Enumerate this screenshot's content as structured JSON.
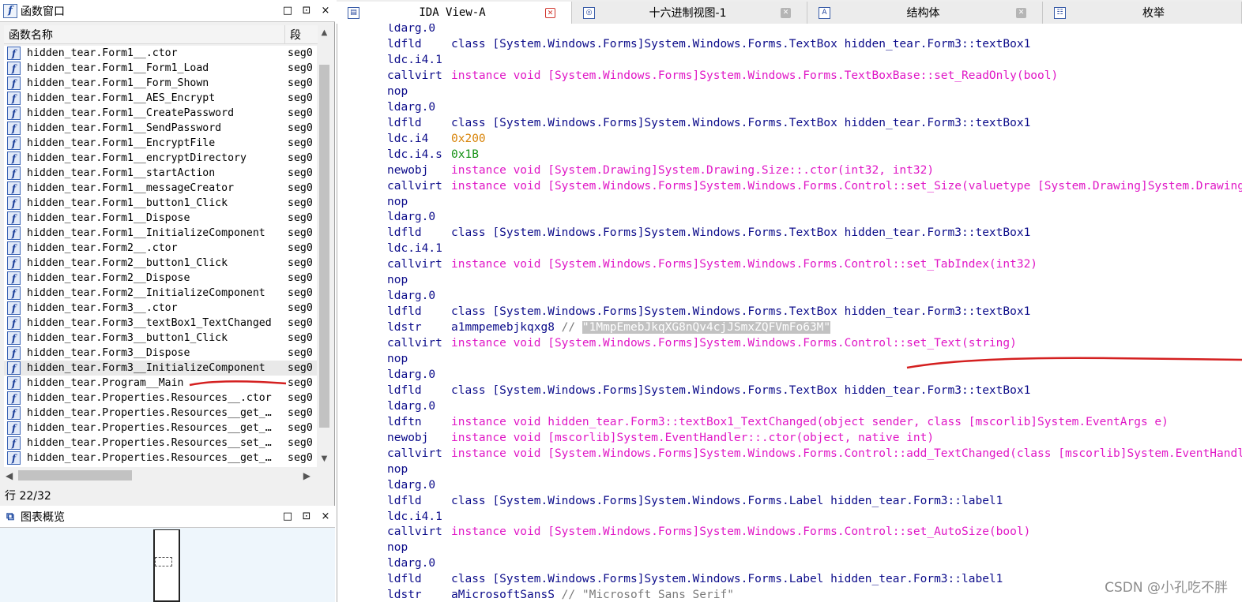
{
  "function_window": {
    "title": "函数窗口",
    "buttons": [
      "□",
      "⊡",
      "×"
    ],
    "col_name": "函数名称",
    "col_seg": "段",
    "functions": [
      {
        "name": "hidden_tear.Form1__.ctor",
        "seg": "seg0"
      },
      {
        "name": "hidden_tear.Form1__Form1_Load",
        "seg": "seg0"
      },
      {
        "name": "hidden_tear.Form1__Form_Shown",
        "seg": "seg0"
      },
      {
        "name": "hidden_tear.Form1__AES_Encrypt",
        "seg": "seg0"
      },
      {
        "name": "hidden_tear.Form1__CreatePassword",
        "seg": "seg0"
      },
      {
        "name": "hidden_tear.Form1__SendPassword",
        "seg": "seg0"
      },
      {
        "name": "hidden_tear.Form1__EncryptFile",
        "seg": "seg0"
      },
      {
        "name": "hidden_tear.Form1__encryptDirectory",
        "seg": "seg0"
      },
      {
        "name": "hidden_tear.Form1__startAction",
        "seg": "seg0"
      },
      {
        "name": "hidden_tear.Form1__messageCreator",
        "seg": "seg0"
      },
      {
        "name": "hidden_tear.Form1__button1_Click",
        "seg": "seg0"
      },
      {
        "name": "hidden_tear.Form1__Dispose",
        "seg": "seg0"
      },
      {
        "name": "hidden_tear.Form1__InitializeComponent",
        "seg": "seg0"
      },
      {
        "name": "hidden_tear.Form2__.ctor",
        "seg": "seg0"
      },
      {
        "name": "hidden_tear.Form2__button1_Click",
        "seg": "seg0"
      },
      {
        "name": "hidden_tear.Form2__Dispose",
        "seg": "seg0"
      },
      {
        "name": "hidden_tear.Form2__InitializeComponent",
        "seg": "seg0"
      },
      {
        "name": "hidden_tear.Form3__.ctor",
        "seg": "seg0"
      },
      {
        "name": "hidden_tear.Form3__textBox1_TextChanged",
        "seg": "seg0"
      },
      {
        "name": "hidden_tear.Form3__button1_Click",
        "seg": "seg0"
      },
      {
        "name": "hidden_tear.Form3__Dispose",
        "seg": "seg0"
      },
      {
        "name": "hidden_tear.Form3__InitializeComponent",
        "seg": "seg0",
        "selected": true
      },
      {
        "name": "hidden_tear.Program__Main",
        "seg": "seg0"
      },
      {
        "name": "hidden_tear.Properties.Resources__.ctor",
        "seg": "seg0"
      },
      {
        "name": "hidden_tear.Properties.Resources__get_…",
        "seg": "seg0"
      },
      {
        "name": "hidden_tear.Properties.Resources__get_…",
        "seg": "seg0"
      },
      {
        "name": "hidden_tear.Properties.Resources__set_…",
        "seg": "seg0"
      },
      {
        "name": "hidden_tear.Properties.Resources__get_…",
        "seg": "seg0"
      }
    ],
    "status": "行 22/32"
  },
  "graph_overview": {
    "title": "图表概览",
    "buttons": [
      "□",
      "⊡",
      "×"
    ]
  },
  "tabs": [
    {
      "label": "IDA View-A",
      "icon": "ida-view-icon",
      "active": true
    },
    {
      "label": "十六进制视图-1",
      "icon": "hex-view-icon",
      "active": false
    },
    {
      "label": "结构体",
      "icon": "structures-icon",
      "active": false
    },
    {
      "label": "枚举",
      "icon": "enums-icon",
      "active": false
    }
  ],
  "code_top": {
    "op": "ldarg.0"
  },
  "code_lines": [
    {
      "op": "ldfld",
      "args": "class [System.Windows.Forms]System.Windows.Forms.TextBox hidden_tear.Form3::textBox1",
      "style": "plain"
    },
    {
      "op": "ldc.i4.1",
      "args": "",
      "style": "plain"
    },
    {
      "op": "callvirt",
      "args": "instance void [System.Windows.Forms]System.Windows.Forms.TextBoxBase::set_ReadOnly(bool)",
      "style": "kw"
    },
    {
      "op": "nop",
      "args": "",
      "style": "plain"
    },
    {
      "op": "ldarg.0",
      "args": "",
      "style": "plain"
    },
    {
      "op": "ldfld",
      "args": "class [System.Windows.Forms]System.Windows.Forms.TextBox hidden_tear.Form3::textBox1",
      "style": "plain"
    },
    {
      "op": "ldc.i4",
      "args": "0x200",
      "style": "num"
    },
    {
      "op": "ldc.i4.s",
      "args": "0x1B",
      "style": "hex"
    },
    {
      "op": "newobj",
      "args": "instance void [System.Drawing]System.Drawing.Size::.ctor(int32, int32)",
      "style": "kw"
    },
    {
      "op": "callvirt",
      "args": "instance void [System.Windows.Forms]System.Windows.Forms.Control::set_Size(valuetype [System.Drawing]System.Drawing.Size)",
      "style": "kw"
    },
    {
      "op": "nop",
      "args": "",
      "style": "plain"
    },
    {
      "op": "ldarg.0",
      "args": "",
      "style": "plain"
    },
    {
      "op": "ldfld",
      "args": "class [System.Windows.Forms]System.Windows.Forms.TextBox hidden_tear.Form3::textBox1",
      "style": "plain"
    },
    {
      "op": "ldc.i4.1",
      "args": "",
      "style": "plain"
    },
    {
      "op": "callvirt",
      "args": "instance void [System.Windows.Forms]System.Windows.Forms.Control::set_TabIndex(int32)",
      "style": "kw"
    },
    {
      "op": "nop",
      "args": "",
      "style": "plain"
    },
    {
      "op": "ldarg.0",
      "args": "",
      "style": "plain"
    },
    {
      "op": "ldfld",
      "args": "class [System.Windows.Forms]System.Windows.Forms.TextBox hidden_tear.Form3::textBox1",
      "style": "plain"
    },
    {
      "op": "ldstr",
      "args": "a1mmpemebjkqxg8",
      "comment": " // ",
      "highlight": "\"1MmpEmebJkqXG8nQv4cjJSmxZQFVmFo63M\"",
      "style": "plain"
    },
    {
      "op": "callvirt",
      "args": "instance void [System.Windows.Forms]System.Windows.Forms.Control::set_Text(string)",
      "style": "kw"
    },
    {
      "op": "nop",
      "args": "",
      "style": "plain"
    },
    {
      "op": "ldarg.0",
      "args": "",
      "style": "plain"
    },
    {
      "op": "ldfld",
      "args": "class [System.Windows.Forms]System.Windows.Forms.TextBox hidden_tear.Form3::textBox1",
      "style": "plain"
    },
    {
      "op": "ldarg.0",
      "args": "",
      "style": "plain"
    },
    {
      "op": "ldftn",
      "args": "instance void hidden_tear.Form3::textBox1_TextChanged(object sender, class [mscorlib]System.EventArgs e)",
      "style": "kw"
    },
    {
      "op": "newobj",
      "args": "instance void [mscorlib]System.EventHandler::.ctor(object, native int)",
      "style": "kw"
    },
    {
      "op": "callvirt",
      "args": "instance void [System.Windows.Forms]System.Windows.Forms.Control::add_TextChanged(class [mscorlib]System.EventHandler)",
      "style": "kw"
    },
    {
      "op": "nop",
      "args": "",
      "style": "plain"
    },
    {
      "op": "ldarg.0",
      "args": "",
      "style": "plain"
    },
    {
      "op": "ldfld",
      "args": "class [System.Windows.Forms]System.Windows.Forms.Label hidden_tear.Form3::label1",
      "style": "plain"
    },
    {
      "op": "ldc.i4.1",
      "args": "",
      "style": "plain"
    },
    {
      "op": "callvirt",
      "args": "instance void [System.Windows.Forms]System.Windows.Forms.Control::set_AutoSize(bool)",
      "style": "kw"
    },
    {
      "op": "nop",
      "args": "",
      "style": "plain"
    },
    {
      "op": "ldarg.0",
      "args": "",
      "style": "plain"
    },
    {
      "op": "ldfld",
      "args": "class [System.Windows.Forms]System.Windows.Forms.Label hidden_tear.Form3::label1",
      "style": "plain"
    },
    {
      "op": "ldstr",
      "args": "aMicrosoftSansS",
      "comment": " // \"Microsoft Sans Serif\"",
      "style": "plain"
    }
  ],
  "watermark": "CSDN @小孔吃不胖",
  "colors": {
    "keyword": "#e018c6",
    "opcode": "#0c0c8a",
    "number": "#d8840a",
    "hex": "#179317",
    "comment": "#7a7a7a",
    "annotation": "#d42020"
  }
}
